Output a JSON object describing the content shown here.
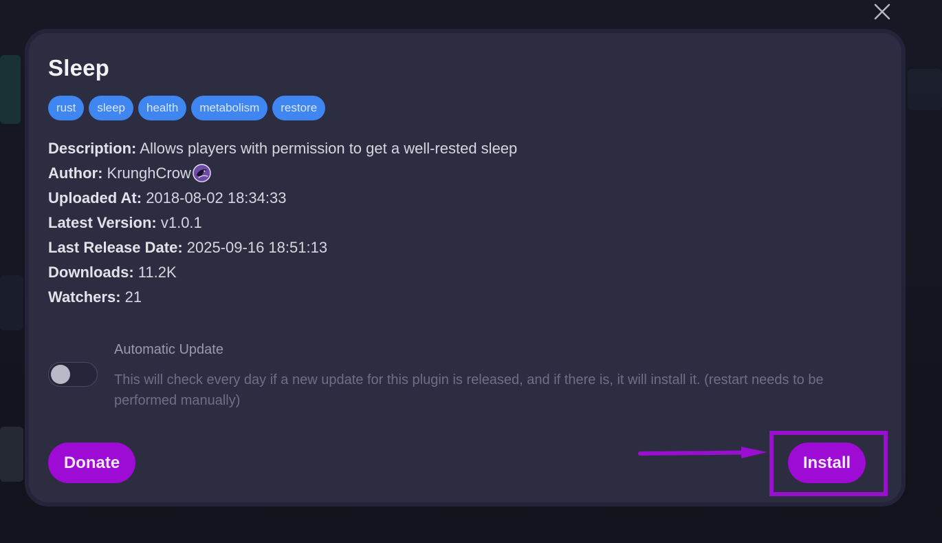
{
  "plugin": {
    "title": "Sleep",
    "tags": [
      "rust",
      "sleep",
      "health",
      "metabolism",
      "restore"
    ],
    "details": [
      {
        "key": "Description:",
        "value": "Allows players with permission to get a well-rested sleep"
      },
      {
        "key": "Author:",
        "value": "KrunghCrow"
      },
      {
        "key": "Uploaded At:",
        "value": "2018-08-02 18:34:33"
      },
      {
        "key": "Latest Version:",
        "value": "v1.0.1"
      },
      {
        "key": "Last Release Date:",
        "value": "2025-09-16 18:51:13"
      },
      {
        "key": "Downloads:",
        "value": "11.2K"
      },
      {
        "key": "Watchers:",
        "value": "21"
      }
    ],
    "author_icon": "crow-avatar-icon"
  },
  "auto_update": {
    "label": "Automatic Update",
    "description": "This will check every day if a new update for this plugin is released, and if there is, it will install it. (restart needs to be performed manually)",
    "enabled": false
  },
  "buttons": {
    "donate": "Donate",
    "install": "Install"
  },
  "icons": {
    "close": "close-icon",
    "arrow": "arrow-right-icon"
  },
  "colors": {
    "accent": "#9d0bd4",
    "tag": "#3f86f1",
    "modal_bg": "#2d2d42"
  }
}
